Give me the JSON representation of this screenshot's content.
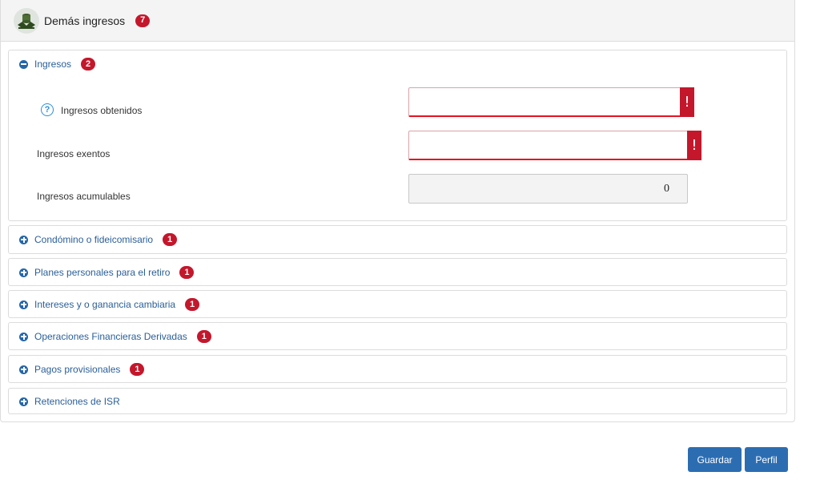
{
  "header": {
    "title": "Demás ingresos",
    "badge": "7"
  },
  "sections": [
    {
      "label": "Ingresos",
      "badge": "2",
      "expanded": true
    },
    {
      "label": "Condómino o fideicomisario",
      "badge": "1",
      "expanded": false
    },
    {
      "label": "Planes personales para el retiro",
      "badge": "1",
      "expanded": false
    },
    {
      "label": "Intereses y o ganancia cambiaria",
      "badge": "1",
      "expanded": false
    },
    {
      "label": "Operaciones Financieras Derivadas",
      "badge": "1",
      "expanded": false
    },
    {
      "label": "Pagos provisionales",
      "badge": "1",
      "expanded": false
    },
    {
      "label": "Retenciones de ISR",
      "badge": "",
      "expanded": false
    }
  ],
  "ingresos": {
    "obtenidos_label": "Ingresos obtenidos",
    "obtenidos_value": "",
    "exentos_label": "Ingresos exentos",
    "exentos_value": "",
    "acumulables_label": "Ingresos acumulables",
    "acumulables_value": "0",
    "error_mark": "!",
    "help_mark": "?"
  },
  "buttons": {
    "save": "Guardar",
    "profile": "Perfil"
  },
  "colors": {
    "accent": "#2c6db2",
    "badge": "#c4172c",
    "error_border": "#e5131e",
    "link": "#2b5f97"
  }
}
